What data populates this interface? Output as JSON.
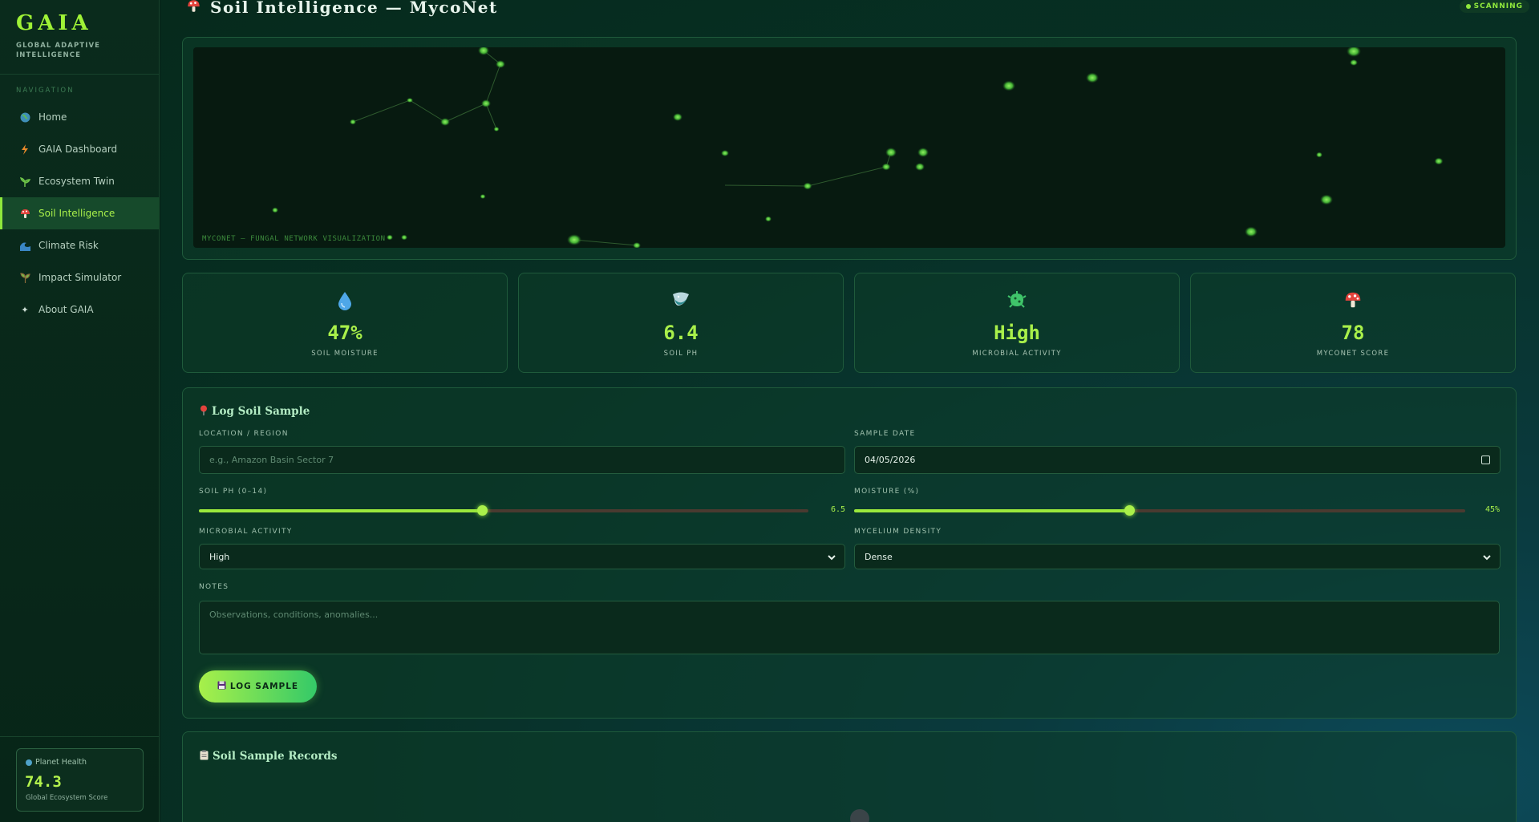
{
  "brand": {
    "name": "GAIA",
    "tagline": "Global Adaptive Intelligence"
  },
  "nav": {
    "section_title": "Navigation",
    "items": [
      {
        "label": "Home",
        "icon": "globe-icon"
      },
      {
        "label": "GAIA Dashboard",
        "icon": "lightning-icon"
      },
      {
        "label": "Ecosystem Twin",
        "icon": "plant-icon"
      },
      {
        "label": "Soil Intelligence",
        "icon": "mushroom-icon",
        "active": true
      },
      {
        "label": "Climate Risk",
        "icon": "wave-icon"
      },
      {
        "label": "Impact Simulator",
        "icon": "seedling-icon"
      },
      {
        "label": "About GAIA",
        "icon": "sparkle-icon"
      }
    ]
  },
  "planet_health": {
    "label": "Planet Health",
    "value": "74.3",
    "sub": "Global Ecosystem Score"
  },
  "header": {
    "title": "Soil Intelligence — MycoNet",
    "status": "SCANNING"
  },
  "network": {
    "caption": "MYCONET — FUNGAL NETWORK VISUALIZATION"
  },
  "stats": [
    {
      "icon": "droplet-icon",
      "value": "47%",
      "label": "Soil Moisture"
    },
    {
      "icon": "test-tube-icon",
      "value": "6.4",
      "label": "Soil pH"
    },
    {
      "icon": "microbe-icon",
      "value": "High",
      "label": "Microbial Activity"
    },
    {
      "icon": "mushroom-icon",
      "value": "78",
      "label": "MycoNet Score"
    }
  ],
  "form": {
    "title": "Log Soil Sample",
    "location_label": "Location / Region",
    "location_placeholder": "e.g., Amazon Basin Sector 7",
    "date_label": "Sample Date",
    "date_value": "04/05/2026",
    "ph_label": "Soil pH (0–14)",
    "ph_value": "6.5",
    "ph_fraction": 0.464,
    "moisture_label": "Moisture (%)",
    "moisture_value": "45%",
    "moisture_fraction": 0.45,
    "microbial_label": "Microbial Activity",
    "microbial_value": "High",
    "mycelium_label": "Mycelium Density",
    "mycelium_value": "Dense",
    "notes_label": "Notes",
    "notes_placeholder": "Observations, conditions, anomalies...",
    "submit_label": "LOG SAMPLE"
  },
  "records": {
    "title": "Soil Sample Records"
  },
  "colors": {
    "accent": "#a9f04a",
    "panel_border": "#1f5a3b",
    "background": "#062016"
  }
}
